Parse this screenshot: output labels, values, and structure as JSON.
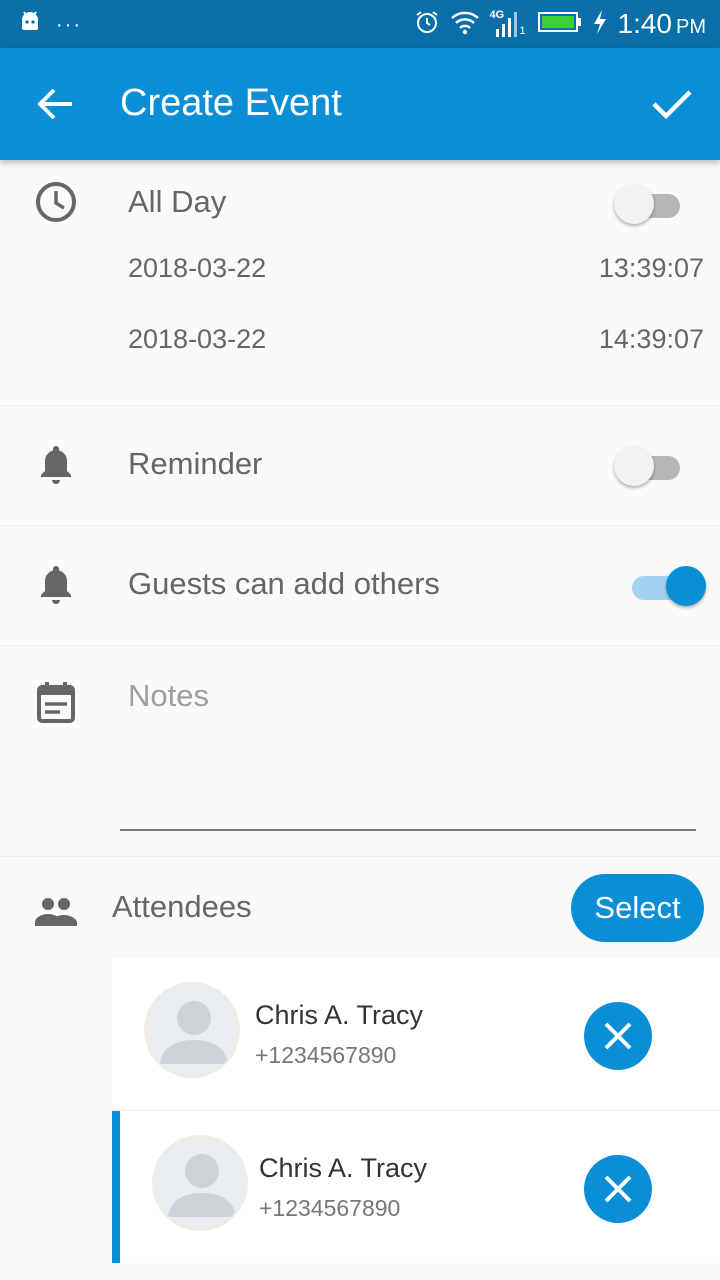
{
  "status_bar": {
    "time": "1:40",
    "ampm": "PM",
    "network": "4G",
    "sim": "1",
    "notification_dots": "···",
    "icons": [
      "android-icon",
      "alarm-icon",
      "wifi-icon",
      "signal-icon",
      "battery-icon",
      "charging-icon"
    ]
  },
  "app_bar": {
    "title": "Create Event",
    "back_icon": "arrow-left-icon",
    "confirm_icon": "check-icon"
  },
  "all_day": {
    "label": "All Day",
    "icon": "clock-icon",
    "enabled": false,
    "start_date": "2018-03-22",
    "start_time": "13:39:07",
    "end_date": "2018-03-22",
    "end_time": "14:39:07"
  },
  "reminder": {
    "label": "Reminder",
    "icon": "bell-icon",
    "enabled": false
  },
  "guests": {
    "label": "Guests can add others",
    "icon": "bell-icon",
    "enabled": true
  },
  "notes": {
    "placeholder": "Notes",
    "icon": "notes-calendar-icon",
    "value": ""
  },
  "attendees": {
    "label": "Attendees",
    "icon": "people-icon",
    "select_label": "Select",
    "list": [
      {
        "name": "Chris A. Tracy",
        "phone": "+1234567890",
        "selected": false
      },
      {
        "name": "Chris A. Tracy",
        "phone": "+1234567890",
        "selected": true
      }
    ]
  },
  "colors": {
    "status_bar": "#0a6fa8",
    "primary": "#0a8fd6",
    "switch_track_on": "#9fd3f0",
    "switch_track_off": "#b6b6b6",
    "icon_gray": "#666666",
    "background": "#fafafa"
  }
}
